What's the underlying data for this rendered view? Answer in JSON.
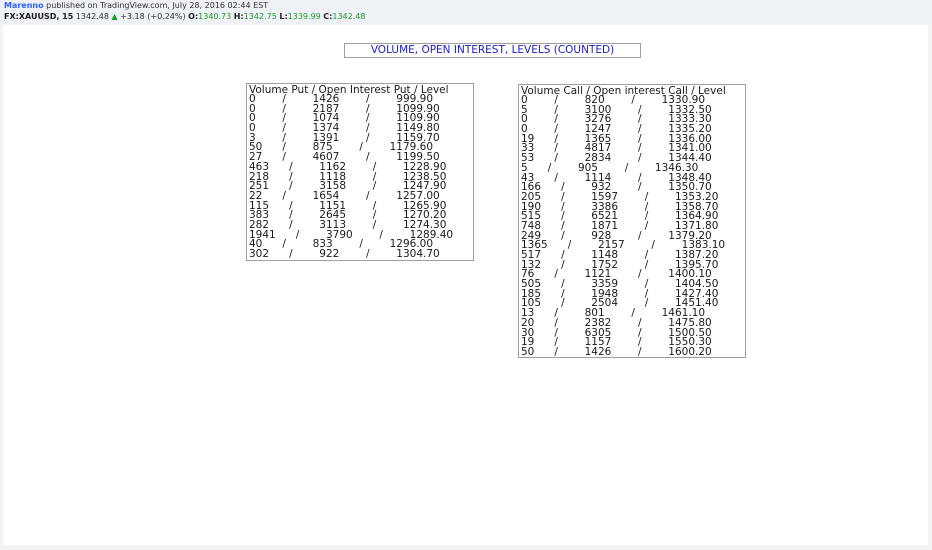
{
  "header": {
    "author": "Marenno",
    "published": "published on TradingView.com, July 28, 2016 02:44 EST",
    "symbol": "FX:XAUUSD, 15",
    "last": "1342.48",
    "change_arrow": "▲",
    "change": "+3.18 (+0.24%)",
    "o_label": "O:",
    "o_value": "1340.73",
    "h_label": "H:",
    "h_value": "1342.75",
    "l_label": "L:",
    "l_value": "1339.99",
    "c_label": "C:",
    "c_value": "1342.48"
  },
  "title": "VOLUME, OPEN INTEREST, LEVELS (COUNTED)",
  "put_panel": {
    "heading": "Volume Put / Open Interest Put / Level",
    "rows": [
      "0        /        1426        /        999.90",
      "0        /        2187        /        1099.90",
      "0        /        1074        /        1109.90",
      "0        /        1374        /        1149.80",
      "3        /        1391        /        1159.70",
      "50      /        875        /        1179.60",
      "27      /        4607        /        1199.50",
      "463      /        1162        /        1228.90",
      "218      /        1118        /        1238.50",
      "251      /        3158        /        1247.90",
      "22      /        1654        /        1257.00",
      "115      /        1151        /        1265.90",
      "383      /        2645        /        1270.20",
      "282      /        3113        /        1274.30",
      "1941      /        3790        /        1289.40",
      "40      /        833        /        1296.00",
      "302      /        922        /        1304.70"
    ]
  },
  "call_panel": {
    "heading": "Volume Call / Open interest Call / Level",
    "rows": [
      "0        /        820        /        1330.90",
      "5        /        3100        /        1332.50",
      "0        /        3276        /        1333.30",
      "0        /        1247        /        1335.20",
      "19      /        1365        /        1336.00",
      "33      /        4817        /        1341.00",
      "53      /        2834        /        1344.40",
      "5      /        905        /        1346.30",
      "43      /        1114        /        1348.40",
      "166      /        932        /        1350.70",
      "205      /        1597        /        1353.20",
      "190      /        3386        /        1358.70",
      "515      /        6521        /        1364.90",
      "748      /        1871        /        1371.80",
      "249      /        928        /        1379.20",
      "1365      /        2157        /        1383.10",
      "517      /        1148        /        1387.20",
      "132      /        1752        /        1395.70",
      "76      /        1121        /        1400.10",
      "505      /        3359        /        1404.50",
      "185      /        1948        /        1427.40",
      "105      /        2504        /        1451.40",
      "13      /        801        /        1461.10",
      "20      /        2382        /        1475.80",
      "30      /        6305        /        1500.50",
      "19      /        1157        /        1550.30",
      "50      /        1426        /        1600.20"
    ]
  },
  "colors": {
    "accent": "#2962ff",
    "up": "#1c9b2a",
    "title": "#1b1bd1"
  }
}
